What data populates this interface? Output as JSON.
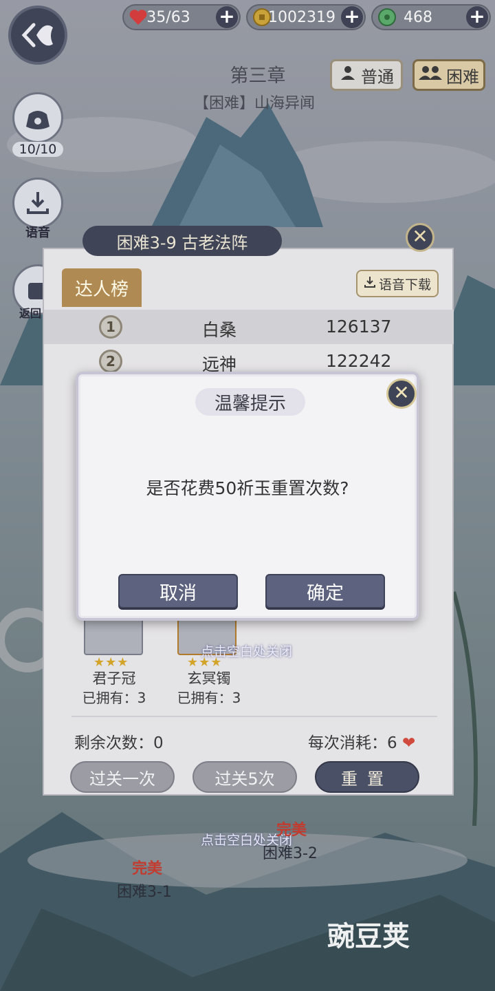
{
  "hud": {
    "stamina": "35/63",
    "coins": "1002319",
    "gems": "468"
  },
  "sidebar": {
    "bag_count": "10/10",
    "voice_label": "语音",
    "back_label": "返回"
  },
  "chapter": {
    "title": "第三章",
    "subtitle": "【困难】山海异闻",
    "mode_normal": "普通",
    "mode_hard": "困难"
  },
  "panel": {
    "title": "困难3-9 古老法阵",
    "close_glyph": "✕",
    "rank_tab": "达人榜",
    "voice_download": "语音下载",
    "rankings": [
      {
        "rank": "1",
        "name": "白桑",
        "score": "126137"
      },
      {
        "rank": "2",
        "name": "远神",
        "score": "122242"
      }
    ],
    "rewards": [
      {
        "stars": "★★★",
        "name": "君子冠",
        "owned": "已拥有：3"
      },
      {
        "stars": "★★★",
        "name": "玄冥镯",
        "owned": "已拥有：3"
      }
    ],
    "remaining": "剩余次数：0",
    "cost": "每次消耗：6",
    "btn_once": "过关一次",
    "btn_five": "过关5次",
    "btn_reset": "重置",
    "tap_close": "点击空白处关闭"
  },
  "stages": {
    "stage1": "困难3-1",
    "stage2": "困难3-2",
    "perfect": "完美"
  },
  "modal": {
    "title": "温馨提示",
    "message": "是否花费50祈玉重置次数?",
    "cancel": "取消",
    "confirm": "确定",
    "close_glyph": "✕"
  },
  "watermark": "豌豆荚"
}
